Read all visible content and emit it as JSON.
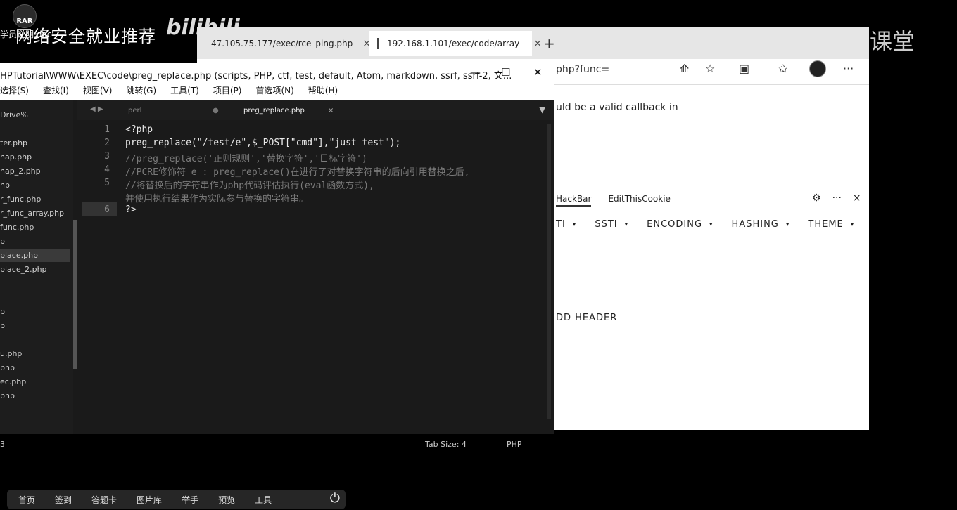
{
  "desktop": {
    "rar_icon_text": "RAR",
    "rar_label": "学员说明.doc",
    "watermark_cn": "网络安全就业推荐",
    "watermark_bili": "bilibili",
    "watermark_tencent": "腾讯课堂"
  },
  "browser": {
    "tabs": [
      {
        "title": "47.105.75.177/exec/rce_ping.php",
        "close": "×"
      },
      {
        "title": "192.168.1.101/exec/code/array_",
        "close": "×"
      }
    ],
    "new_tab": "+",
    "url_tail": "php?func=",
    "toolbar_icons": [
      "translate-icon",
      "star-icon",
      "extension-icon",
      "favorites-icon",
      "profile-icon",
      "more-icon"
    ],
    "content_text": "uld be a valid callback in",
    "devtools_tabs": [
      "HackBar",
      "EditThisCookie"
    ],
    "devtools_icons": {
      "gear": "⚙",
      "more": "···",
      "close": "×"
    },
    "hackbar_menu": [
      "TI",
      "SSTI",
      "ENCODING",
      "HASHING",
      "THEME"
    ],
    "add_header": "DD HEADER"
  },
  "editor": {
    "title": "HPTutorial\\WWW\\EXEC\\code\\preg_replace.php (scripts, PHP, ctf, test, default, Atom, markdown, ssrf, ssrf-2, 文...",
    "window_buttons": {
      "minimize": "—",
      "maximize": "☐",
      "close": "✕"
    },
    "menu": [
      "选择(S)",
      "查找(I)",
      "视图(V)",
      "跳转(G)",
      "工具(T)",
      "项目(P)",
      "首选项(N)",
      "帮助(H)"
    ],
    "sidebar_items": [
      "Drive%",
      "ter.php",
      "nap.php",
      "nap_2.php",
      "hp",
      "r_func.php",
      "r_func_array.php",
      "func.php",
      "p",
      "place.php",
      "place_2.php",
      "",
      "p",
      "p",
      "u.php",
      "php",
      "ec.php",
      "php"
    ],
    "active_sidebar_index": 9,
    "tabs": {
      "nav": "◀ ▶",
      "perl": "perl",
      "perl_dot": "●",
      "active": "preg_replace.php",
      "close": "×",
      "menu": "▼"
    },
    "line_numbers": [
      "1",
      "2",
      "3",
      "4",
      "5",
      "",
      "6"
    ],
    "code_lines": [
      {
        "text": "<?php",
        "kind": "code"
      },
      {
        "text": "preg_replace(\"/test/e\",$_POST[\"cmd\"],\"just test\");",
        "kind": "code"
      },
      {
        "text": "//preg_replace('正则规则','替换字符','目标字符')",
        "kind": "comment"
      },
      {
        "text": "//PCRE修饰符 e : preg_replace()在进行了对替换字符串的后向引用替换之后,",
        "kind": "comment"
      },
      {
        "text": "//将替换后的字符串作为php代码评估执行(eval函数方式),",
        "kind": "comment"
      },
      {
        "text": "并使用执行结果作为实际参与替换的字符串。",
        "kind": "comment"
      },
      {
        "text": "?>",
        "kind": "code"
      }
    ],
    "status": {
      "left": "3",
      "tab_size": "Tab Size: 4",
      "syntax": "PHP"
    }
  },
  "taskbar": {
    "items": [
      "首页",
      "签到",
      "答题卡",
      "图片库",
      "举手",
      "预览",
      "工具"
    ],
    "power_icon": "⏻"
  }
}
